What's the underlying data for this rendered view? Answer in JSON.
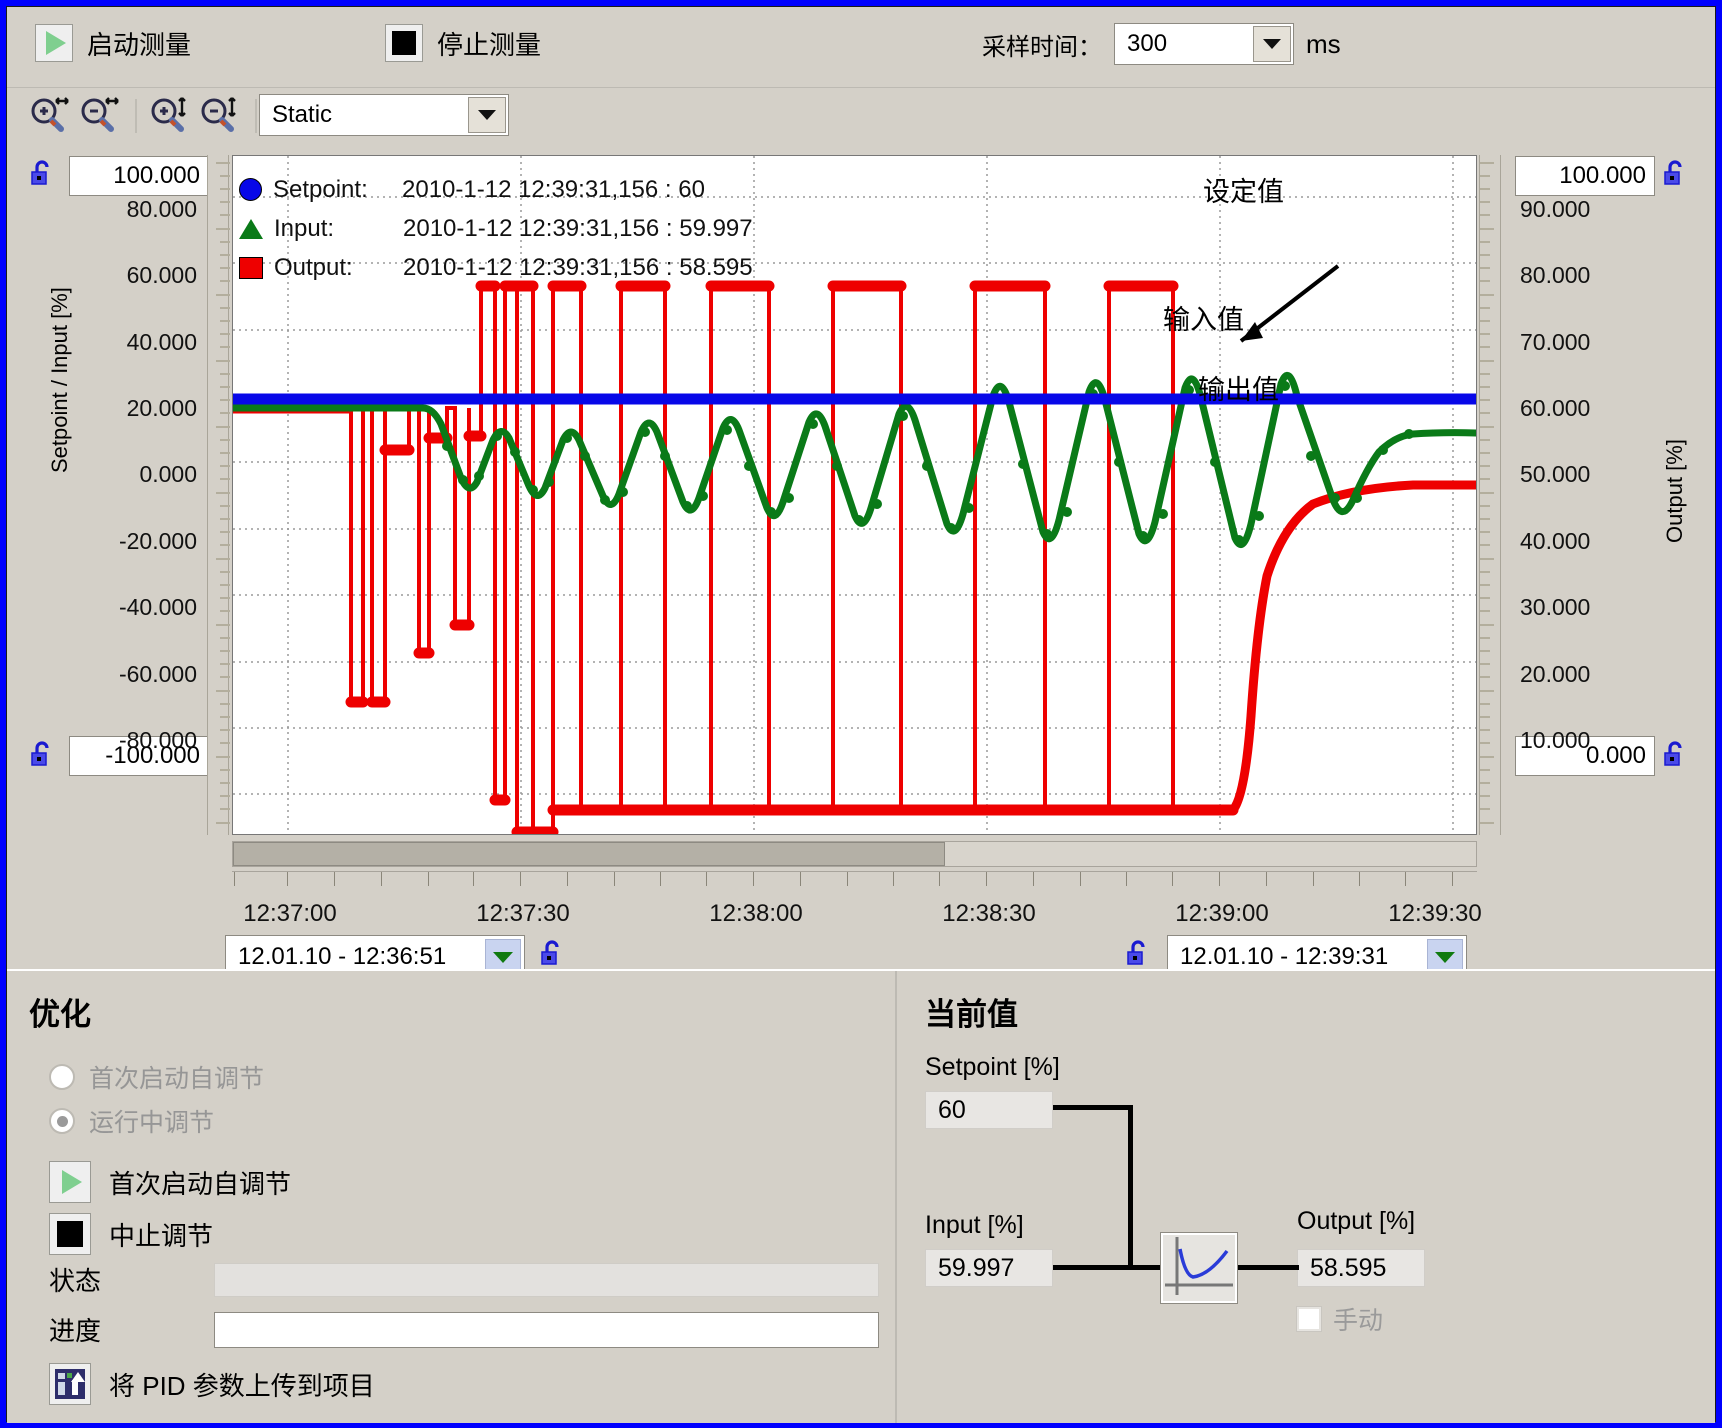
{
  "toolbar": {
    "start_measure": "启动测量",
    "stop_measure": "停止测量",
    "sampling_label": "采样时间：",
    "sampling_value": "300",
    "sampling_unit": "ms",
    "start_icon": "play-icon",
    "stop_icon": "stop-icon"
  },
  "toolbar2": {
    "zoom_in_x": "zoom-in-horizontal-icon",
    "zoom_out_x": "zoom-out-horizontal-icon",
    "zoom_in_y": "zoom-in-vertical-icon",
    "zoom_out_y": "zoom-out-vertical-icon",
    "mode_value": "Static"
  },
  "chart": {
    "left_axis_label": "Setpoint / Input  [%]",
    "right_axis_label": "Output  [%]",
    "left_max_box": "100.000",
    "left_min_box": "-100.000",
    "right_max_box": "100.000",
    "right_min_box": "0.000",
    "legend": [
      {
        "marker": "circle",
        "color": "#0707e8",
        "name": "Setpoint:",
        "value": "2010-1-12 12:39:31,156 : 60"
      },
      {
        "marker": "triangle",
        "color": "#0a7a18",
        "name": "Input:",
        "value": "2010-1-12 12:39:31,156 : 59.997"
      },
      {
        "marker": "square",
        "color": "#ee0000",
        "name": "Output:",
        "value": "2010-1-12 12:39:31,156 : 58.595"
      }
    ],
    "annotations": [
      {
        "text": "设定值"
      },
      {
        "text": "输入值"
      },
      {
        "text": "输出值"
      }
    ],
    "start_time_field": "12.01.10 - 12:36:51",
    "end_time_field": "12.01.10 - 12:39:31",
    "lock_icon": "unlocked-padlock-icon",
    "dropdown_icon": "chevron-down-icon"
  },
  "chart_data": {
    "type": "line",
    "title": "",
    "xlabel": "",
    "ylabel": "Setpoint / Input  [%]",
    "y2label": "Output  [%]",
    "ylim": [
      -100,
      100
    ],
    "y2lim": [
      0,
      100
    ],
    "yticks": [
      "100.000",
      "80.000",
      "60.000",
      "40.000",
      "20.000",
      "0.000",
      "-20.000",
      "-40.000",
      "-60.000",
      "-80.000",
      "-100.000"
    ],
    "y2ticks": [
      "100.000",
      "90.000",
      "80.000",
      "70.000",
      "60.000",
      "50.000",
      "40.000",
      "30.000",
      "20.000",
      "10.000",
      "0.000"
    ],
    "xticks": [
      "12:37:00",
      "12:37:30",
      "12:38:00",
      "12:38:30",
      "12:39:00",
      "12:39:30"
    ],
    "xlim": [
      "12:36:51",
      "12:39:31"
    ],
    "grid": true,
    "legend_position": "top-left",
    "series": [
      {
        "name": "Setpoint",
        "color": "#0707e8",
        "final_value": 60,
        "style": "flat-line"
      },
      {
        "name": "Input",
        "color": "#0a7a18",
        "final_value": 59.997,
        "style": "oscillating-decaying"
      },
      {
        "name": "Output",
        "color": "#ee0000",
        "final_value": 58.595,
        "style": "square-pulse-then-settle"
      }
    ]
  },
  "optimization": {
    "title": "优化",
    "radio_first_start": "首次启动自调节",
    "radio_running": "运行中调节",
    "btn_first_start": "首次启动自调节",
    "btn_abort": "中止调节",
    "status_label": "状态",
    "status_value": "",
    "progress_label": "进度",
    "progress_value": "",
    "upload_label": "将 PID 参数上传到项目",
    "upload_icon": "upload-pid-icon",
    "selected_radio": "运行中调节"
  },
  "current_values": {
    "title": "当前值",
    "setpoint_label": "Setpoint [%]",
    "setpoint_value": "60",
    "input_label": "Input [%]",
    "input_value": "59.997",
    "output_label": "Output [%]",
    "output_value": "58.595",
    "manual_label": "手动",
    "manual_checked": false,
    "pid_icon": "pid-response-curve-icon"
  },
  "colors": {
    "setpoint": "#0707e8",
    "input": "#0a7a18",
    "output": "#ee0000",
    "window_border": "#0000ff",
    "panel_bg": "#d4d0c8"
  }
}
